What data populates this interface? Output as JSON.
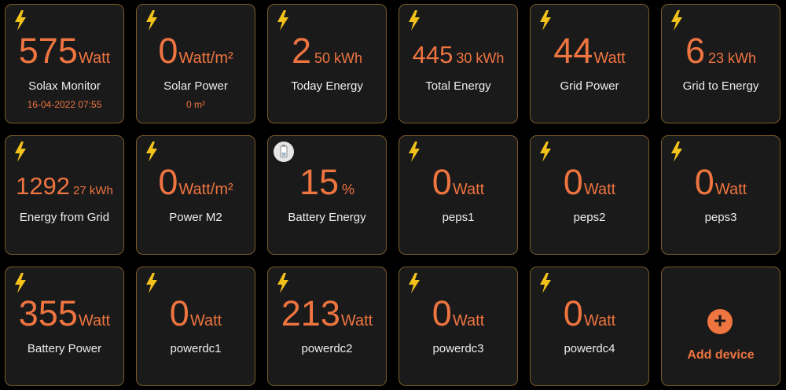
{
  "accent_color": "#ee7440",
  "tiles": [
    {
      "icon": "lightning-icon",
      "value": "575",
      "unit": "Watt",
      "label": "Solax Monitor",
      "sub": "16-04-2022 07:55"
    },
    {
      "icon": "lightning-icon",
      "value": "0",
      "unit": "Watt/m²",
      "label": "Solar Power",
      "sub": "0 m²"
    },
    {
      "icon": "lightning-icon",
      "value": "2",
      "unit": "50 kWh",
      "label": "Today Energy"
    },
    {
      "icon": "lightning-icon",
      "value": "445",
      "unit": "30 kWh",
      "label": "Total Energy"
    },
    {
      "icon": "lightning-icon",
      "value": "44",
      "unit": "Watt",
      "label": "Grid Power"
    },
    {
      "icon": "lightning-icon",
      "value": "6",
      "unit": "23 kWh",
      "label": "Grid to Energy"
    },
    {
      "icon": "lightning-icon",
      "value": "1292",
      "unit": "27 kWh",
      "label": "Energy from Grid"
    },
    {
      "icon": "lightning-icon",
      "value": "0",
      "unit": "Watt/m²",
      "label": "Power M2"
    },
    {
      "icon": "battery-icon",
      "value": "15",
      "unit": "%",
      "label": "Battery Energy"
    },
    {
      "icon": "lightning-icon",
      "value": "0",
      "unit": "Watt",
      "label": "peps1"
    },
    {
      "icon": "lightning-icon",
      "value": "0",
      "unit": "Watt",
      "label": "peps2"
    },
    {
      "icon": "lightning-icon",
      "value": "0",
      "unit": "Watt",
      "label": "peps3"
    },
    {
      "icon": "lightning-icon",
      "value": "355",
      "unit": "Watt",
      "label": "Battery Power"
    },
    {
      "icon": "lightning-icon",
      "value": "0",
      "unit": "Watt",
      "label": "powerdc1"
    },
    {
      "icon": "lightning-icon",
      "value": "213",
      "unit": "Watt",
      "label": "powerdc2"
    },
    {
      "icon": "lightning-icon",
      "value": "0",
      "unit": "Watt",
      "label": "powerdc3"
    },
    {
      "icon": "lightning-icon",
      "value": "0",
      "unit": "Watt",
      "label": "powerdc4"
    }
  ],
  "add_device": {
    "icon": "plus-icon",
    "symbol": "+",
    "label": "Add device"
  }
}
